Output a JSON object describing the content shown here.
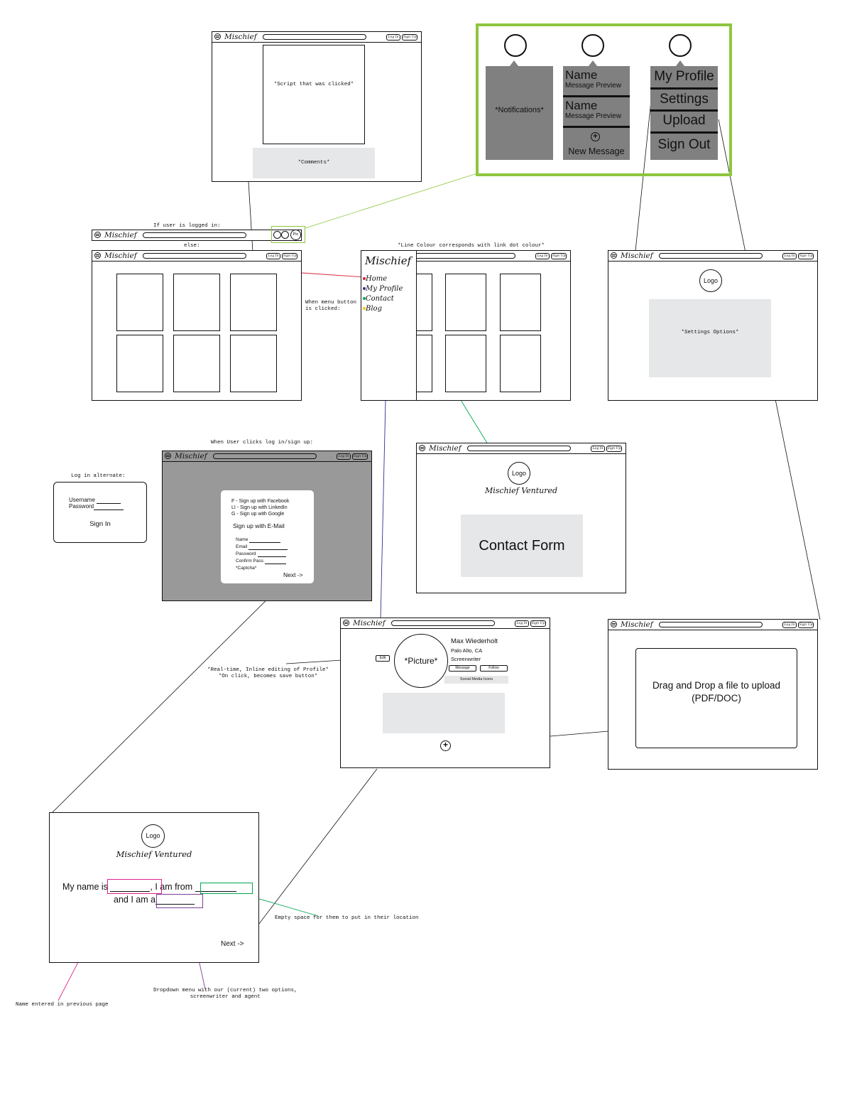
{
  "brand": "Mischief",
  "topbar": {
    "login": "Log In",
    "signup": "Sign Up"
  },
  "script_view": {
    "content": "*Script that was clicked*",
    "comments": "*Comments*"
  },
  "labels": {
    "logged_in": "If user is logged in:",
    "else": "else:",
    "line_colour": "*Line Colour corresponds with link dot colour*",
    "menu_clicked": "When menu button\nis clicked:",
    "login_signup": "When User clicks log in/sign up:",
    "login_alt": "Log in alternate:",
    "realtime": "*Real-time, Inline editing of Profile*\n*On click, becomes save button*",
    "empty_space": "Empty space for them to put in their location",
    "dropdown": "Dropdown menu with our (current) two options,\nscreenwriter and agent",
    "name_prev": "Name entered in previous page"
  },
  "logged_in_bar": {
    "pic": "Pic"
  },
  "dropdowns": {
    "notifications": "*Notifications*",
    "messages": [
      {
        "name": "Name",
        "preview": "Message Preview"
      },
      {
        "name": "Name",
        "preview": "Message Preview"
      }
    ],
    "new_message": "New Message",
    "profile_menu": [
      "My Profile",
      "Settings",
      "Upload",
      "Sign Out"
    ]
  },
  "side_menu": {
    "title": "Mischief",
    "items": [
      {
        "label": "Home",
        "color": "#d6202f"
      },
      {
        "label": "My Profile",
        "color": "#2e3192"
      },
      {
        "label": "Contact",
        "color": "#00a651"
      },
      {
        "label": "Blog",
        "color": "#f7c800"
      }
    ]
  },
  "settings_page": {
    "logo": "Logo",
    "options": "*Settings Options*"
  },
  "signup_form": {
    "fb": "F - Sign up with Facebook",
    "li": "LI - Sign up with LinkedIn",
    "g": "G - Sign up with Google",
    "email_title": "Sign up with E-Mail",
    "fields": [
      "Name",
      "Email",
      "Password",
      "Confirm Pass"
    ],
    "captcha": "*Captcha*",
    "next": "Next ->"
  },
  "login_alt_box": {
    "username": "Username",
    "password": "Password",
    "signin": "Sign In"
  },
  "contact_page": {
    "logo": "Logo",
    "title": "Mischief Ventured",
    "form": "Contact Form"
  },
  "profile_page": {
    "picture": "*Picture*",
    "edit": "Edit",
    "name": "Max Wiederholt",
    "location": "Palo Alto, CA",
    "role": "Screenwriter",
    "message": "Message",
    "follow": "Follow",
    "social": "Social Media Icons"
  },
  "upload_page": {
    "text": "Drag and Drop a file to upload\n(PDF/DOC)"
  },
  "onboarding": {
    "logo": "Logo",
    "title": "Mischief Ventured",
    "line1a": "My name is",
    "line1b": ", I am from",
    "line2": "and I am a",
    "next": "Next ->"
  },
  "colors": {
    "accent_green": "#8dc63f",
    "panel_gray": "#808080",
    "light_gray": "#e6e7e8",
    "red_link": "#d6202f",
    "blue_link": "#2e3192",
    "green_link": "#00a651",
    "pink": "#e0218a",
    "purple": "#7f3f98",
    "teal": "#00a651"
  }
}
